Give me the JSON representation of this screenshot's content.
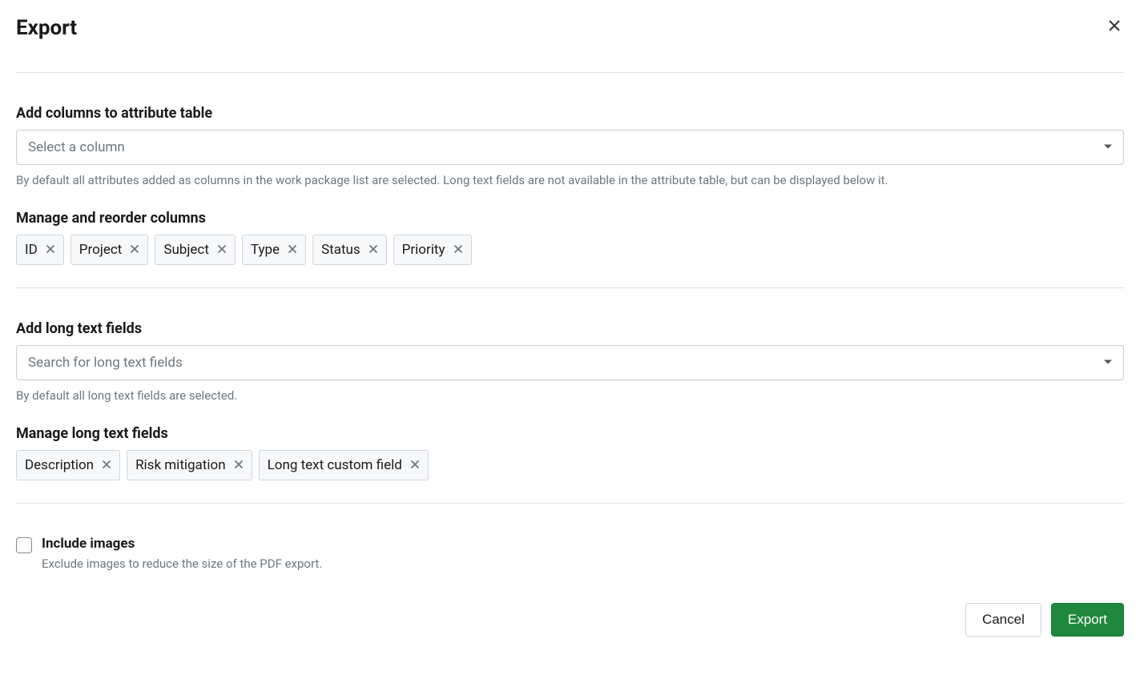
{
  "header": {
    "title": "Export"
  },
  "columns_section": {
    "label": "Add columns to attribute table",
    "placeholder": "Select a column",
    "help": "By default all attributes added as columns in the work package list are selected. Long text fields are not available in the attribute table, but can be displayed below it."
  },
  "manage_columns": {
    "label": "Manage and reorder columns",
    "chips": [
      "ID",
      "Project",
      "Subject",
      "Type",
      "Status",
      "Priority"
    ]
  },
  "longtext_section": {
    "label": "Add long text fields",
    "placeholder": "Search for long text fields",
    "help": "By default all long text fields are selected."
  },
  "manage_longtext": {
    "label": "Manage long text fields",
    "chips": [
      "Description",
      "Risk mitigation",
      "Long text custom field"
    ]
  },
  "include_images": {
    "label": "Include images",
    "help": "Exclude images to reduce the size of the PDF export."
  },
  "footer": {
    "cancel": "Cancel",
    "export": "Export"
  }
}
